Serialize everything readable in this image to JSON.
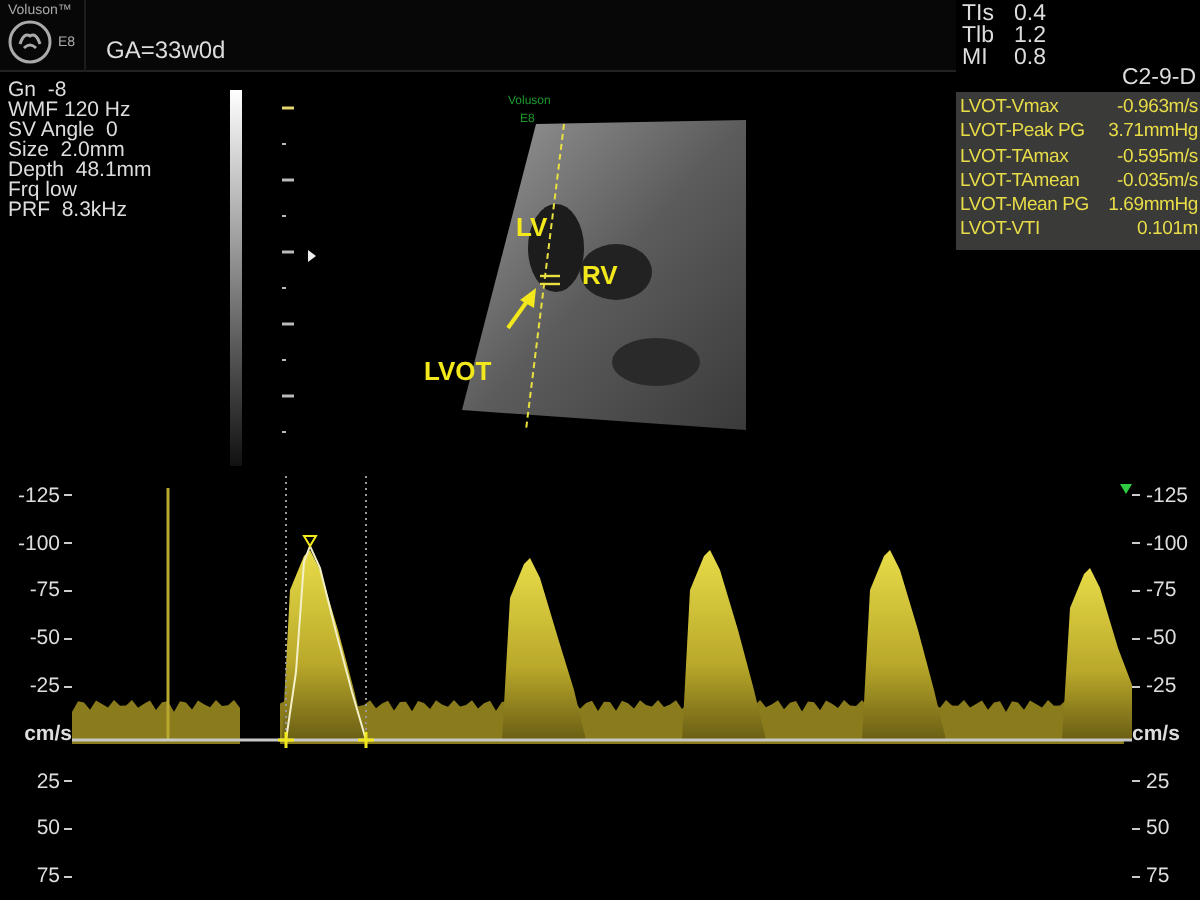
{
  "header": {
    "brand": "Voluson™",
    "model": "E8",
    "gestational_age": "GA=33w0d"
  },
  "safety_indices": [
    {
      "label": "TIs",
      "value": "0.4"
    },
    {
      "label": "Tlb",
      "value": "1.2"
    },
    {
      "label": "MI",
      "value": "0.8"
    }
  ],
  "probe": "C2-9-D",
  "settings": [
    "Gn  -8",
    "WMF 120 Hz",
    "SV Angle  0",
    "Size  2.0mm",
    "Depth  48.1mm",
    "Frq low",
    "PRF  8.3kHz"
  ],
  "image": {
    "logo_brand": "Voluson",
    "logo_model": "E8",
    "annotations": [
      {
        "text": "LV",
        "kind": "label"
      },
      {
        "text": "RV",
        "kind": "label"
      },
      {
        "text": "LVOT",
        "kind": "arrow_label"
      }
    ]
  },
  "measurements": [
    {
      "name": "LVOT-Vmax",
      "value": "-0.963m/s"
    },
    {
      "name": "LVOT-Peak PG",
      "value": "3.71mmHg"
    },
    {
      "name": "LVOT-TAmax",
      "value": "-0.595m/s"
    },
    {
      "name": "LVOT-TAmean",
      "value": "-0.035m/s"
    },
    {
      "name": "LVOT-Mean PG",
      "value": "1.69mmHg"
    },
    {
      "name": "LVOT-VTI",
      "value": "0.101m"
    }
  ],
  "spectrum": {
    "left_axis": [
      "-125",
      "-100",
      "-75",
      "-50",
      "-25",
      "cm/s",
      "25",
      "50",
      "75"
    ],
    "right_axis": [
      "-125",
      "-100",
      "-75",
      "-50",
      "-25",
      "cm/s",
      "25",
      "50",
      "75"
    ]
  }
}
